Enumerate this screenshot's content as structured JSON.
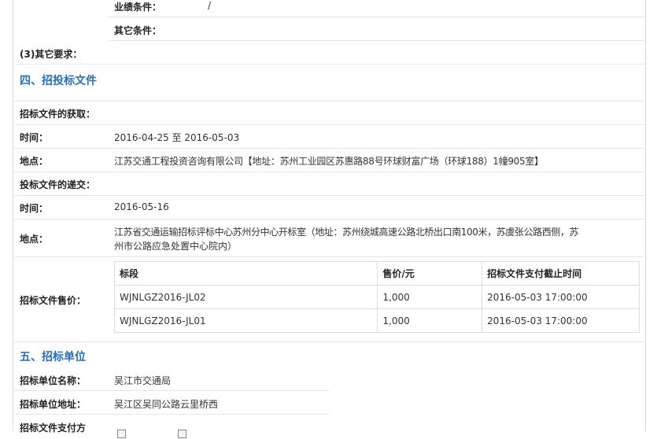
{
  "top_rows": [
    {
      "label": "业绩条件：",
      "value": "/"
    },
    {
      "label": "其它条件：",
      "value": ""
    }
  ],
  "other_req_label": "(3)其它要求：",
  "section4_title": "四、招投标文件",
  "obtain": {
    "header": "招标文件的获取：",
    "time_label": "时间：",
    "time_value": "2016-04-25 至 2016-05-03",
    "place_label": "地点：",
    "place_value": "江苏交通工程投资咨询有限公司【地址：苏州工业园区苏惠路88号环球财富广场（环球188）1幢905室】"
  },
  "submit": {
    "header": "投标文件的递交：",
    "time_label": "时间：",
    "time_value": "2016-05-16",
    "place_label": "地点：",
    "place_line1": "江苏省交通运输招标评标中心苏州分中心开标室（地址：苏州绕城高速公路北桥出口南100米，苏虞张公路西侧，苏",
    "place_line2": "州市公路应急处置中心院内）"
  },
  "fee": {
    "label": "招标文件售价：",
    "headers": [
      "标段",
      "售价/元",
      "招标文件支付截止时间"
    ],
    "rows": [
      [
        "WJNLGZ2016-JL02",
        "1,000",
        "2016-05-03 17:00:00"
      ],
      [
        "WJNLGZ2016-JL01",
        "1,000",
        "2016-05-03 17:00:00"
      ]
    ]
  },
  "section5_title": "五、招标单位",
  "unit": {
    "name_label": "招标单位名称：",
    "name_value": "吴江市交通局",
    "addr_label": "招标单位地址：",
    "addr_value": "吴江区吴同公路云里桥西",
    "pay_label": "招标文件支付方"
  }
}
